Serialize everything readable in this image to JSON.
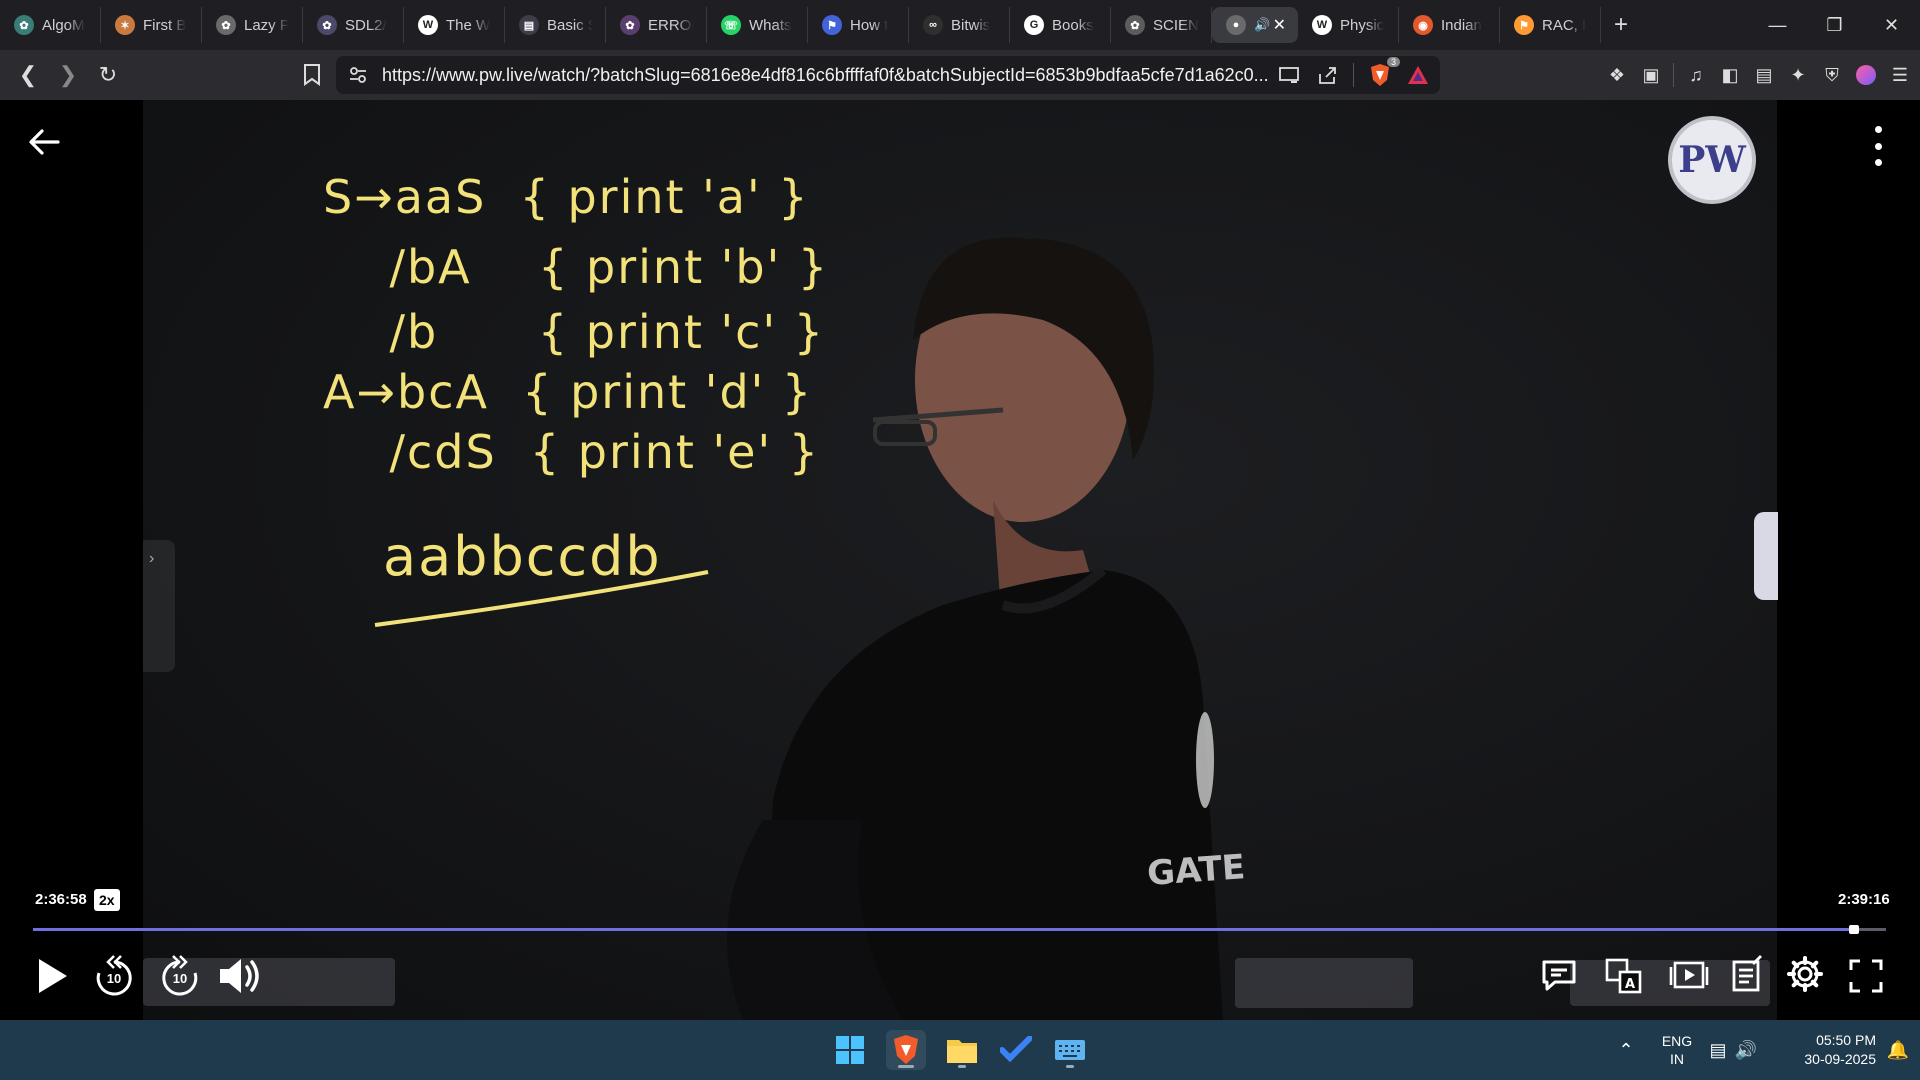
{
  "browser": {
    "tabs": [
      {
        "title": "AlgoM",
        "favicon": "chatgpt-icon",
        "color": "#3a7d77"
      },
      {
        "title": "First B",
        "favicon": "claude-icon",
        "color": "#c97b3f"
      },
      {
        "title": "Lazy F",
        "favicon": "chatgpt-icon",
        "color": "#6a6a6a"
      },
      {
        "title": "SDL2/",
        "favicon": "chatgpt-icon",
        "color": "#4a4a68"
      },
      {
        "title": "The W",
        "favicon": "wordpress-icon",
        "color": "#ffffff"
      },
      {
        "title": "Basic S",
        "favicon": "page-icon",
        "color": "#3d3d4a"
      },
      {
        "title": "ERROI",
        "favicon": "chatgpt-icon",
        "color": "#5a3f6e"
      },
      {
        "title": "Whats",
        "favicon": "whatsapp-icon",
        "color": "#25d366"
      },
      {
        "title": "How t",
        "favicon": "bookmark-icon",
        "color": "#4363d8"
      },
      {
        "title": "Bitwis",
        "favicon": "geeks-icon",
        "color": "#2f2f2f"
      },
      {
        "title": "Books",
        "favicon": "google-icon",
        "color": "#ffffff"
      },
      {
        "title": "SCIEN",
        "favicon": "chatgpt-icon",
        "color": "#5c5c5c"
      },
      {
        "title": "",
        "favicon": "pw-icon",
        "color": "#6a6a6a",
        "active": true,
        "audio": true
      },
      {
        "title": "Physic",
        "favicon": "wikipedia-icon",
        "color": "#ffffff"
      },
      {
        "title": "Indian",
        "favicon": "globe-icon",
        "color": "#e25a2c"
      },
      {
        "title": "RAC, I",
        "favicon": "india-flag-icon",
        "color": "#ff9933"
      }
    ],
    "new_tab": "+",
    "url": "https://www.pw.live/watch/?batchSlug=6816e8e4df816c6bffffaf0f&batchSubjectId=6853b9bdfaa5cfe7d1a62c0...",
    "shield_badge": "3"
  },
  "video": {
    "board_lines": [
      "S→aaS  { print 'a' }",
      "    /bA    { print 'b' }",
      "    /b      { print 'c' }",
      "A→bcA  { print 'd' }",
      "    /cdS  { print 'e' }",
      "aabbccdb"
    ],
    "shirt_text": "GATE",
    "logo_text": "PW",
    "current_time": "2:36:58",
    "speed": "2x",
    "duration": "2:39:16",
    "progress": 0.9825,
    "rewind_label": "10",
    "forward_label": "10",
    "accent": "#6f6fe0"
  },
  "taskbar": {
    "lang_top": "ENG",
    "lang_bottom": "IN",
    "time": "05:50 PM",
    "date": "30-09-2025"
  }
}
